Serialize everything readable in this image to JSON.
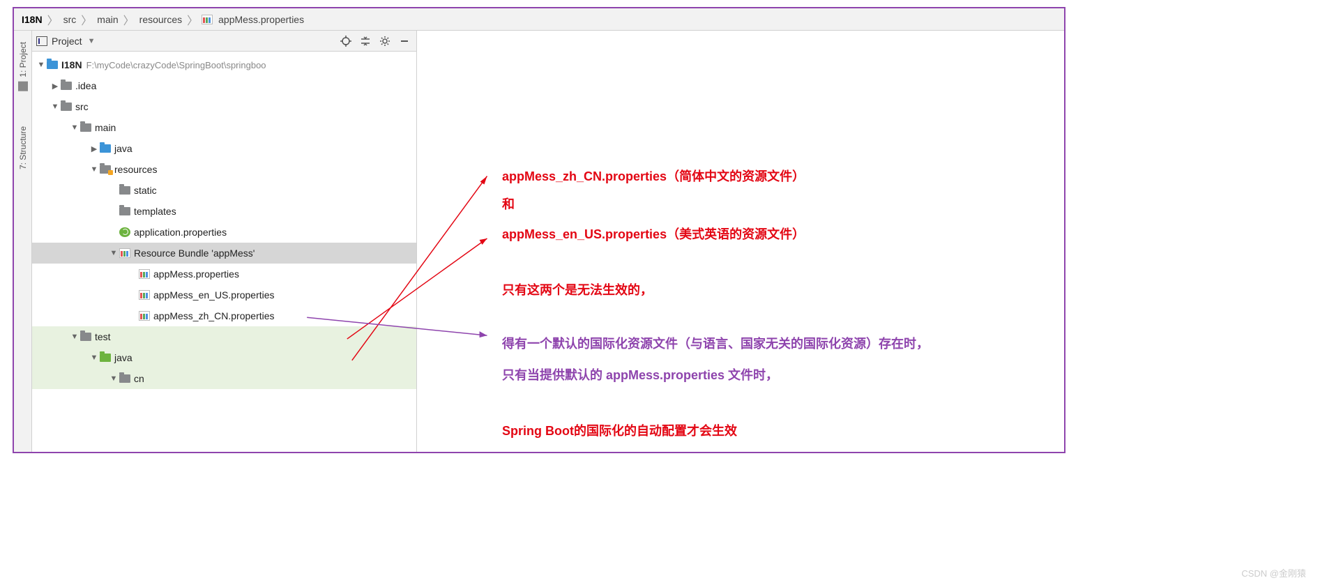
{
  "breadcrumbs": [
    "I18N",
    "src",
    "main",
    "resources",
    "appMess.properties"
  ],
  "panel": {
    "title": "Project",
    "tools": {
      "target": "target-icon",
      "collapse": "collapse-icon",
      "settings": "gear-icon",
      "hide": "minimize-icon"
    }
  },
  "side_tabs": {
    "project": "1: Project",
    "structure": "7: Structure"
  },
  "tree": {
    "root": {
      "name": "I18N",
      "path": "F:\\myCode\\crazyCode\\SpringBoot\\springboo"
    },
    "idea": ".idea",
    "src": "src",
    "main": "main",
    "java": "java",
    "resources": "resources",
    "static": "static",
    "templates": "templates",
    "app_props": "application.properties",
    "bundle": "Resource Bundle 'appMess'",
    "f_default": "appMess.properties",
    "f_en": "appMess_en_US.properties",
    "f_zh": "appMess_zh_CN.properties",
    "test": "test",
    "test_java": "java",
    "cn": "cn"
  },
  "annotations": {
    "l1": "appMess_zh_CN.properties（简体中文的资源文件）",
    "l2": "和",
    "l3": "appMess_en_US.properties（美式英语的资源文件）",
    "l4": "只有这两个是无法生效的，",
    "l5": "得有一个默认的国际化资源文件（与语言、国家无关的国际化资源）存在时，",
    "l6": "只有当提供默认的 appMess.properties 文件时，",
    "l7": "Spring Boot的国际化的自动配置才会生效"
  },
  "watermark": "CSDN @金刚猿"
}
